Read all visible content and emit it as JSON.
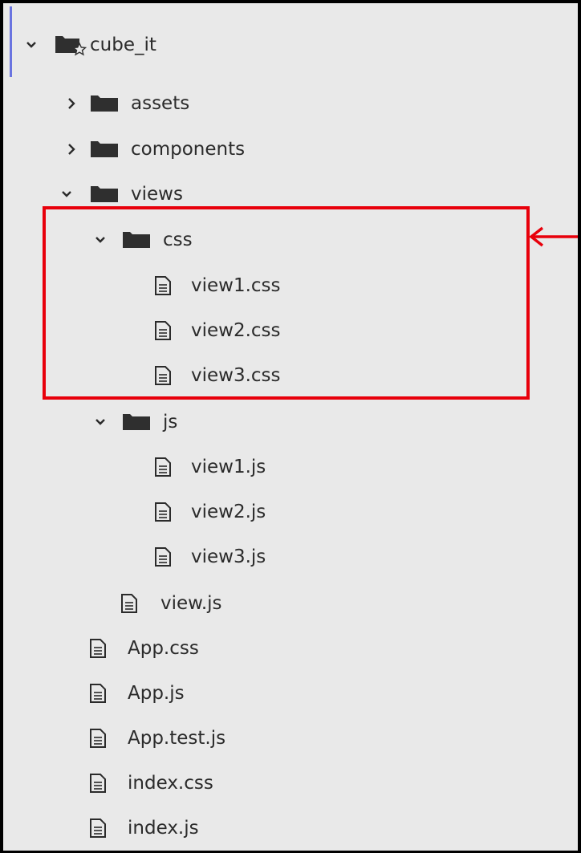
{
  "tree": {
    "root": {
      "label": "cube_it",
      "icon": "project-folder-icon",
      "expanded": true
    },
    "items": [
      {
        "id": "assets",
        "label": "assets",
        "type": "folder",
        "expanded": false
      },
      {
        "id": "components",
        "label": "components",
        "type": "folder",
        "expanded": false
      },
      {
        "id": "views",
        "label": "views",
        "type": "folder",
        "expanded": true
      },
      {
        "id": "css",
        "label": "css",
        "type": "folder",
        "expanded": true
      },
      {
        "id": "view1-css",
        "label": "view1.css",
        "type": "file"
      },
      {
        "id": "view2-css",
        "label": "view2.css",
        "type": "file"
      },
      {
        "id": "view3-css",
        "label": "view3.css",
        "type": "file"
      },
      {
        "id": "js",
        "label": "js",
        "type": "folder",
        "expanded": true
      },
      {
        "id": "view1-js",
        "label": "view1.js",
        "type": "file"
      },
      {
        "id": "view2-js",
        "label": "view2.js",
        "type": "file"
      },
      {
        "id": "view3-js",
        "label": "view3.js",
        "type": "file"
      },
      {
        "id": "view-js",
        "label": "view.js",
        "type": "file"
      },
      {
        "id": "app-css",
        "label": "App.css",
        "type": "file"
      },
      {
        "id": "app-js",
        "label": "App.js",
        "type": "file"
      },
      {
        "id": "app-test-js",
        "label": "App.test.js",
        "type": "file"
      },
      {
        "id": "index-css",
        "label": "index.css",
        "type": "file"
      },
      {
        "id": "index-js",
        "label": "index.js",
        "type": "file"
      }
    ]
  },
  "annotation": {
    "highlight": "css folder",
    "color": "#e8000b",
    "arrow_icon": "left-arrow-icon"
  },
  "colors": {
    "panel_background": "#e9e9e9",
    "text": "#2b2b2b",
    "folder_icon": "#2f2f2f",
    "accent_bar": "#6a74e0"
  }
}
